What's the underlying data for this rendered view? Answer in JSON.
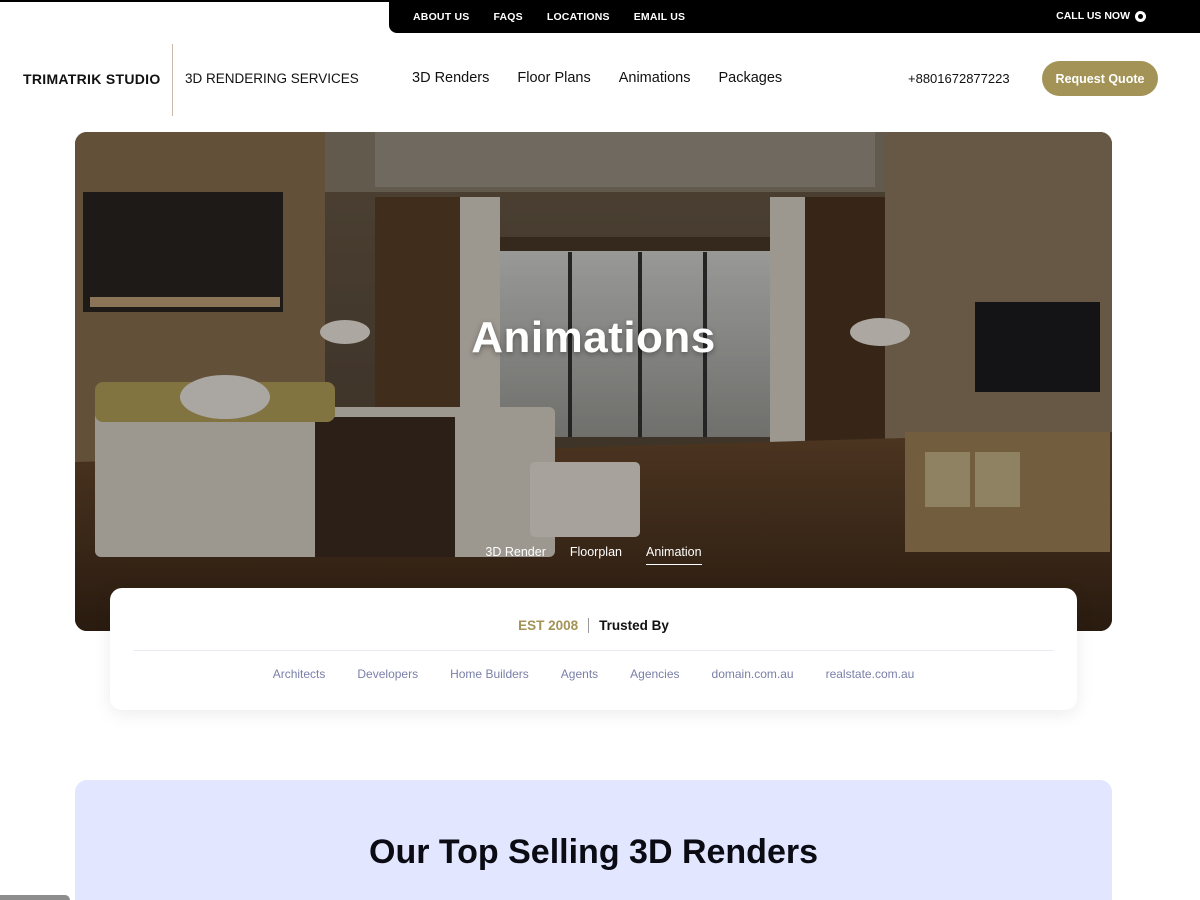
{
  "topbar": {
    "links": [
      "ABOUT US",
      "FAQS",
      "LOCATIONS",
      "EMAIL US"
    ],
    "call_label": "CALL US NOW"
  },
  "header": {
    "brand": "TRIMATRIK STUDIO",
    "subtitle": "3D RENDERING SERVICES",
    "nav": [
      "3D Renders",
      "Floor Plans",
      "Animations",
      "Packages"
    ],
    "phone": "+8801672877223",
    "cta": "Request Quote"
  },
  "hero": {
    "title": "Animations",
    "tabs": [
      "3D Render",
      "Floorplan",
      "Animation"
    ],
    "active_tab": "Animation"
  },
  "trusted": {
    "est": "EST 2008",
    "label": "Trusted By",
    "items": [
      "Architects",
      "Developers",
      "Home Builders",
      "Agents",
      "Agencies",
      "domain.com.au",
      "realstate.com.au"
    ]
  },
  "section": {
    "heading": "Our Top Selling 3D Renders"
  },
  "colors": {
    "accent_gold": "#a39356",
    "section_bg": "#e2e6ff",
    "trusted_item": "#7a7fa8"
  }
}
